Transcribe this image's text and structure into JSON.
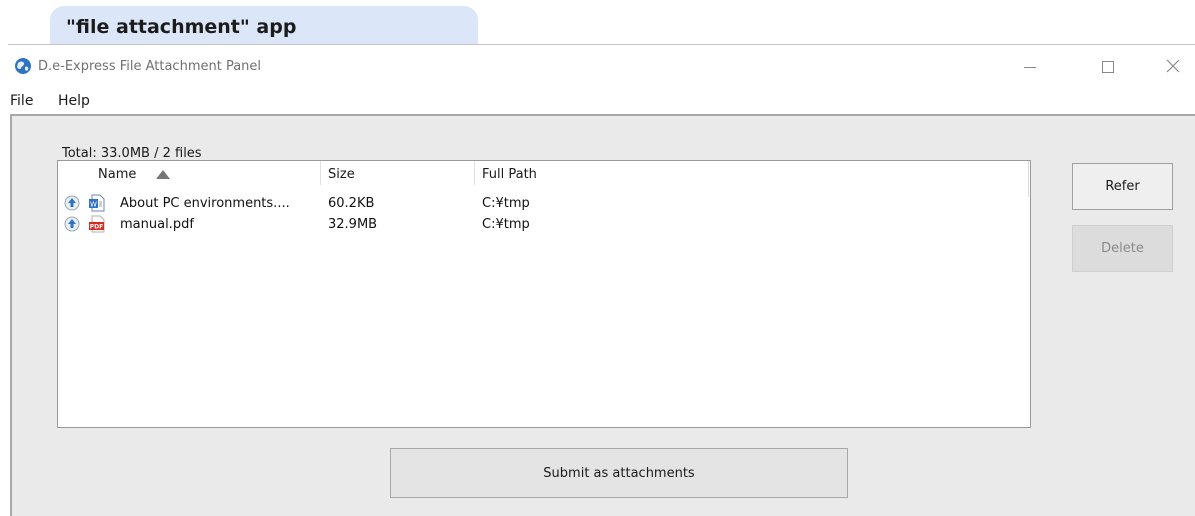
{
  "caption": "\"file attachment\" app",
  "window": {
    "title": "D.e-Express File Attachment Panel",
    "controls": {
      "minimize": "—",
      "maximize": "☐",
      "close": "✕"
    }
  },
  "menu": [
    "File",
    "Help"
  ],
  "summary": "Total: 33.0MB / 2 files",
  "list": {
    "columns": [
      "Name",
      "Size",
      "Full Path"
    ],
    "sort": {
      "column": "Name",
      "direction": "ascending"
    },
    "rows": [
      {
        "name": "About PC environments....",
        "size": "60.2KB",
        "path": "C:¥tmp",
        "type_icon": "word-document-icon"
      },
      {
        "name": "manual.pdf",
        "size": "32.9MB",
        "path": "C:¥tmp",
        "type_icon": "pdf-document-icon",
        "type_icon_text": "PDF"
      }
    ]
  },
  "buttons": {
    "refer": "Refer",
    "delete": "Delete",
    "submit": "Submit as attachments"
  },
  "colors": {
    "accent_blue": "#2f74c0",
    "pdf_red": "#d32b22",
    "caption_bg": "#dbe6f8"
  }
}
